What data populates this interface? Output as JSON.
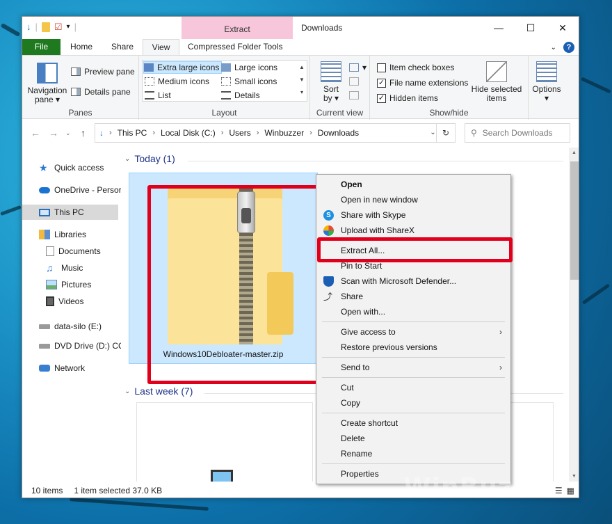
{
  "window": {
    "title": "Downloads",
    "context_tab_head": "Extract"
  },
  "ribbon_tabs": [
    {
      "label": "File"
    },
    {
      "label": "Home"
    },
    {
      "label": "Share"
    },
    {
      "label": "View"
    },
    {
      "label": "Compressed Folder Tools"
    }
  ],
  "ribbon": {
    "panes": {
      "label": "Panes",
      "navigation_pane": "Navigation pane",
      "preview_pane": "Preview pane",
      "details_pane": "Details pane"
    },
    "layout": {
      "label": "Layout",
      "items": [
        "Extra large icons",
        "Large icons",
        "Medium icons",
        "Small icons",
        "List",
        "Details"
      ]
    },
    "current_view": {
      "label": "Current view",
      "sort_by": "Sort by"
    },
    "show_hide": {
      "label": "Show/hide",
      "item_check_boxes": "Item check boxes",
      "file_name_extensions": "File name extensions",
      "hidden_items": "Hidden items",
      "hide_selected": "Hide selected items"
    },
    "options": "Options"
  },
  "address": {
    "path": [
      "This PC",
      "Local Disk (C:)",
      "Users",
      "Winbuzzer",
      "Downloads"
    ],
    "search_placeholder": "Search Downloads"
  },
  "nav_pane": {
    "quick_access": "Quick access",
    "onedrive": "OneDrive - Persor",
    "this_pc": "This PC",
    "libraries": "Libraries",
    "documents": "Documents",
    "music": "Music",
    "pictures": "Pictures",
    "videos": "Videos",
    "data_silo": "data-silo (E:)",
    "dvd": "DVD Drive (D:) CC",
    "network": "Network"
  },
  "content": {
    "today_header": "Today (1)",
    "file_name": "Windows10Debloater-master.zip",
    "last_week_header": "Last week (7)"
  },
  "status": {
    "items": "10 items",
    "selected": "1 item selected  37.0 KB"
  },
  "context_menu": {
    "open": "Open",
    "open_new_window": "Open in new window",
    "share_skype": "Share with Skype",
    "upload_sharex": "Upload with ShareX",
    "extract_all": "Extract All...",
    "pin_to_start": "Pin to Start",
    "scan_defender": "Scan with Microsoft Defender...",
    "share": "Share",
    "open_with": "Open with...",
    "give_access": "Give access to",
    "restore_versions": "Restore previous versions",
    "send_to": "Send to",
    "cut": "Cut",
    "copy": "Copy",
    "create_shortcut": "Create shortcut",
    "delete": "Delete",
    "rename": "Rename",
    "properties": "Properties"
  },
  "watermark": "WinBuzzer"
}
